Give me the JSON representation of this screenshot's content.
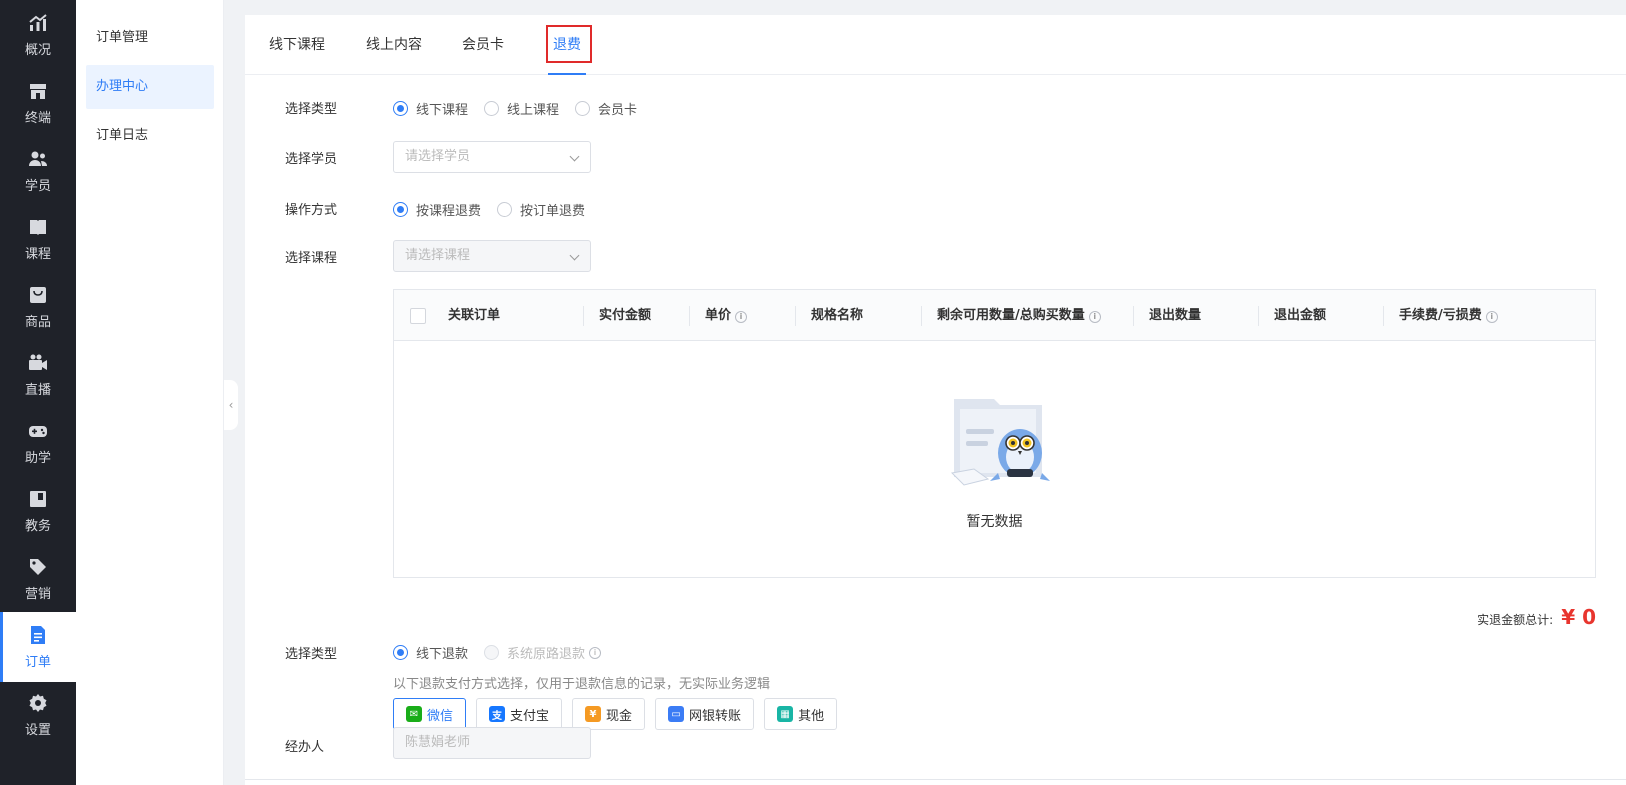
{
  "nav": {
    "items": [
      {
        "label": "概况",
        "icon": "chart-trend-icon"
      },
      {
        "label": "终端",
        "icon": "store-icon"
      },
      {
        "label": "学员",
        "icon": "users-icon"
      },
      {
        "label": "课程",
        "icon": "book-icon"
      },
      {
        "label": "商品",
        "icon": "bag-icon"
      },
      {
        "label": "直播",
        "icon": "video-camera-icon"
      },
      {
        "label": "助学",
        "icon": "gamepad-icon"
      },
      {
        "label": "教务",
        "icon": "notebook-icon"
      },
      {
        "label": "营销",
        "icon": "tag-icon"
      },
      {
        "label": "订单",
        "icon": "document-icon",
        "active": true
      },
      {
        "label": "设置",
        "icon": "gear-icon"
      }
    ]
  },
  "subnav": {
    "items": [
      {
        "label": "订单管理"
      },
      {
        "label": "办理中心",
        "active": true
      },
      {
        "label": "订单日志"
      }
    ]
  },
  "tabs": [
    {
      "label": "线下课程"
    },
    {
      "label": "线上内容"
    },
    {
      "label": "会员卡"
    },
    {
      "label": "退费",
      "active": true
    }
  ],
  "form": {
    "type_label": "选择类型",
    "type_options": [
      "线下课程",
      "线上课程",
      "会员卡"
    ],
    "student_label": "选择学员",
    "student_placeholder": "请选择学员",
    "method_label": "操作方式",
    "method_options": [
      "按课程退费",
      "按订单退费"
    ],
    "course_label": "选择课程",
    "course_placeholder": "请选择课程",
    "refund_type_label": "选择类型",
    "refund_type_options": [
      "线下退款",
      "系统原路退款"
    ],
    "hint": "以下退款支付方式选择，仅用于退款信息的记录，无实际业务逻辑",
    "handler_label": "经办人",
    "handler_value": "陈慧娟老师"
  },
  "table": {
    "columns": [
      "关联订单",
      "实付金额",
      "单价",
      "规格名称",
      "剩余可用数量/总购买数量",
      "退出数量",
      "退出金额",
      "手续费/亏损费"
    ],
    "empty_text": "暂无数据"
  },
  "total": {
    "label": "实退金额总计:",
    "value": "¥ 0"
  },
  "pay_methods": [
    {
      "label": "微信",
      "color": "#1aad19",
      "active": true
    },
    {
      "label": "支付宝",
      "color": "#1677ff"
    },
    {
      "label": "现金",
      "color": "#f59a23"
    },
    {
      "label": "网银转账",
      "color": "#3b7cf5"
    },
    {
      "label": "其他",
      "color": "#19b5a5"
    }
  ],
  "colors": {
    "accent": "#2f7df6",
    "nav_bg": "#1f2229",
    "total_red": "#e8352e",
    "highlight_red": "#e02a2a"
  }
}
